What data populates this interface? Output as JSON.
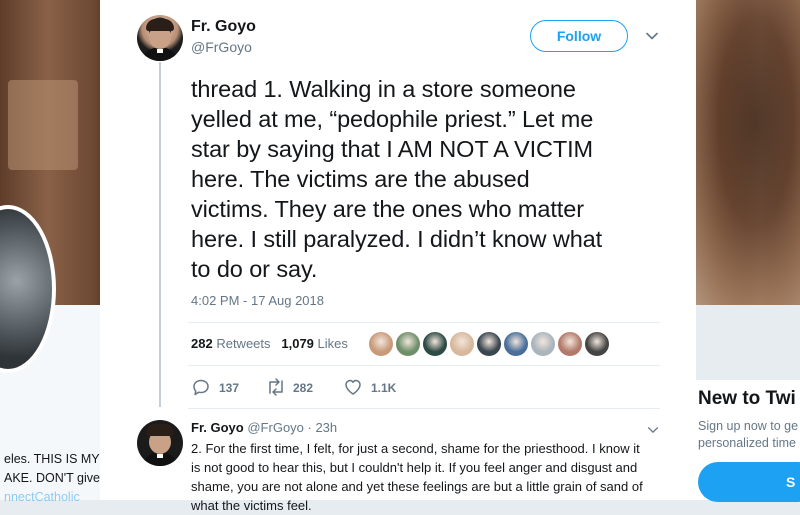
{
  "background": {
    "bio_lines": [
      "eles. THIS IS MY",
      "AKE. DON'T give",
      "nnectCatholic"
    ],
    "sidebar_title": "New to Twi",
    "sidebar_text": [
      "Sign up now to ge",
      "personalized time"
    ],
    "sidebar_button": "S"
  },
  "tweet": {
    "author_name": "Fr. Goyo",
    "author_handle": "@FrGoyo",
    "follow_label": "Follow",
    "text_lines": [
      "thread 1. Walking in a store someone",
      "yelled at me, “pedophile priest.” Let me",
      "star by saying that I AM NOT A VICTIM",
      "here. The victims are the abused",
      "victims. They are the ones who matter",
      "here. I still paralyzed. I didn’t know what",
      "to do or say."
    ],
    "timestamp": "4:02 PM - 17 Aug 2018",
    "retweets_count": "282",
    "retweets_label": "Retweets",
    "likes_count": "1,079",
    "likes_label": "Likes",
    "actions": {
      "reply_count": "137",
      "retweet_count": "282",
      "like_count": "1.1K"
    },
    "liker_colors": [
      "#c99a7a",
      "#6f8f6a",
      "#2d4a44",
      "#d8b89c",
      "#3a4650",
      "#4a6f9a",
      "#aab4bc",
      "#b27a6a",
      "#444"
    ]
  },
  "reply": {
    "author_name": "Fr. Goyo",
    "author_handle": "@FrGoyo · 23h",
    "text_lines": [
      "2. For the first time, I felt, for just a second, shame for the priesthood. I know it",
      "is not good to hear this, but I couldn't help it. If you feel anger and disgust and",
      "shame, you are not alone and yet these feelings are but a little grain of sand of",
      "what the victims feel."
    ]
  }
}
